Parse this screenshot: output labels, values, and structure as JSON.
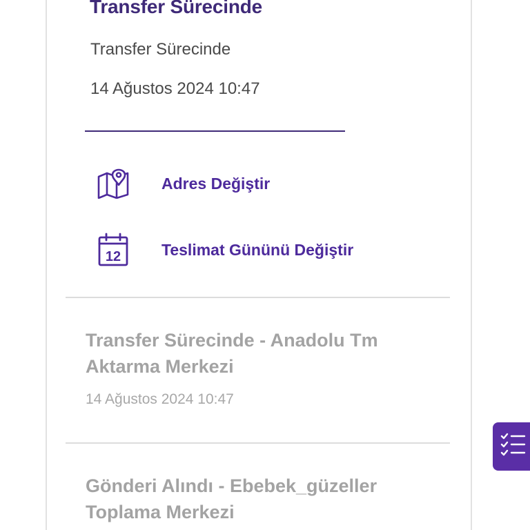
{
  "current_status": {
    "title": "Transfer Sürecinde",
    "subtitle": "Transfer Sürecinde",
    "date": "14 Ağustos 2024 10:47"
  },
  "actions": {
    "change_address": {
      "label": "Adres Değiştir",
      "icon": "map-pin-icon"
    },
    "change_delivery_day": {
      "label": "Teslimat Gününü Değiştir",
      "icon": "calendar-icon",
      "icon_text": "12"
    }
  },
  "history": [
    {
      "title": "Transfer Sürecinde - Anadolu Tm Aktarma Merkezi",
      "date": "14 Ağustos 2024 10:47"
    },
    {
      "title": "Gönderi Alındı - Ebebek_güzeller Toplama Merkezi"
    }
  ],
  "floating_button": {
    "icon": "checklist-icon"
  },
  "colors": {
    "primary": "#4d2a9c",
    "title": "#3f2a78",
    "muted": "#a3a3a3",
    "fab": "#5a2ea6"
  }
}
